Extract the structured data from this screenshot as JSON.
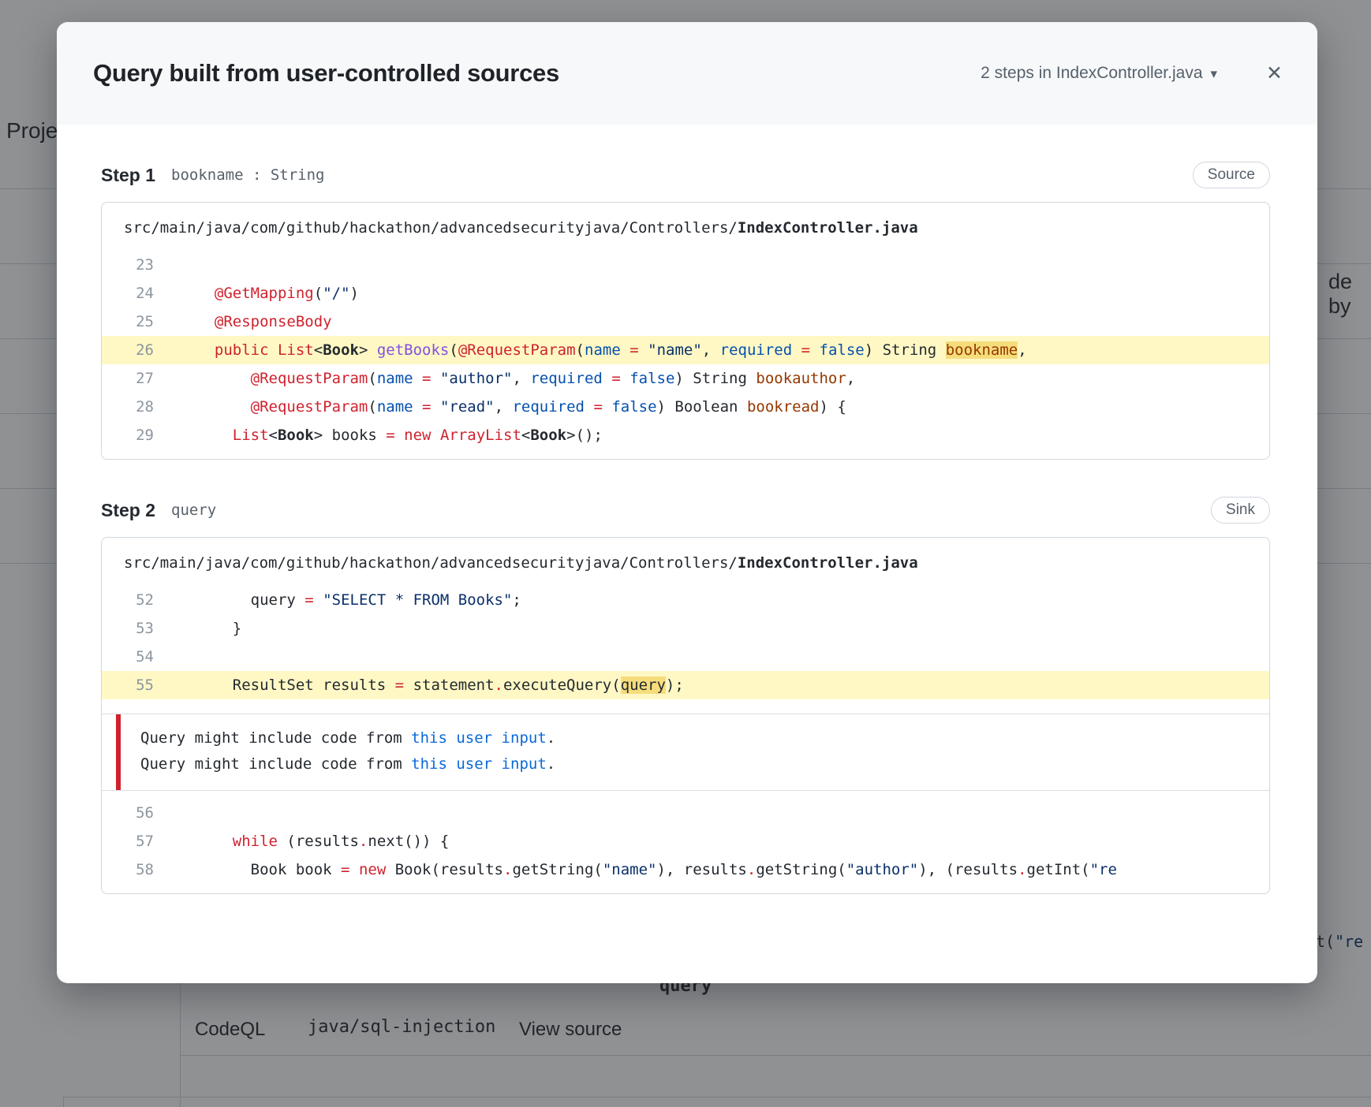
{
  "modal": {
    "title": "Query built from user-controlled sources",
    "steps_dropdown": "2 steps in IndexController.java",
    "icons": {
      "close": "✕",
      "caret": "▾"
    },
    "steps": [
      {
        "label": "Step 1",
        "sublabel": "bookname : String",
        "badge": "Source",
        "file_path_prefix": "src/main/java/com/github/hackathon/advancedsecurityjava/Controllers/",
        "file_name": "IndexController.java",
        "blocks": [
          {
            "type": "lines",
            "lines": [
              {
                "num": "23",
                "indent": 0,
                "hl": false,
                "seg": []
              },
              {
                "num": "24",
                "indent": 2,
                "hl": false,
                "seg": [
                  [
                    "k",
                    "@GetMapping"
                  ],
                  [
                    "p",
                    "("
                  ],
                  [
                    "s",
                    "\"/\""
                  ],
                  [
                    "p",
                    ")"
                  ]
                ]
              },
              {
                "num": "25",
                "indent": 2,
                "hl": false,
                "seg": [
                  [
                    "k",
                    "@ResponseBody"
                  ]
                ]
              },
              {
                "num": "26",
                "indent": 2,
                "hl": true,
                "seg": [
                  [
                    "k",
                    "public"
                  ],
                  [
                    "p",
                    " "
                  ],
                  [
                    "k",
                    "List"
                  ],
                  [
                    "p",
                    "<"
                  ],
                  [
                    "t",
                    "Book"
                  ],
                  [
                    "p",
                    "> "
                  ],
                  [
                    "e",
                    "getBooks"
                  ],
                  [
                    "p",
                    "("
                  ],
                  [
                    "k",
                    "@RequestParam"
                  ],
                  [
                    "p",
                    "("
                  ],
                  [
                    "c",
                    "name"
                  ],
                  [
                    "p",
                    " "
                  ],
                  [
                    "k",
                    "="
                  ],
                  [
                    "p",
                    " "
                  ],
                  [
                    "s",
                    "\"name\""
                  ],
                  [
                    "p",
                    ", "
                  ],
                  [
                    "c",
                    "required"
                  ],
                  [
                    "p",
                    " "
                  ],
                  [
                    "k",
                    "="
                  ],
                  [
                    "p",
                    " "
                  ],
                  [
                    "c",
                    "false"
                  ],
                  [
                    "p",
                    ") String "
                  ],
                  [
                    "vh",
                    "bookname"
                  ],
                  [
                    "p",
                    ","
                  ]
                ]
              },
              {
                "num": "27",
                "indent": 6,
                "hl": false,
                "seg": [
                  [
                    "k",
                    "@RequestParam"
                  ],
                  [
                    "p",
                    "("
                  ],
                  [
                    "c",
                    "name"
                  ],
                  [
                    "p",
                    " "
                  ],
                  [
                    "k",
                    "="
                  ],
                  [
                    "p",
                    " "
                  ],
                  [
                    "s",
                    "\"author\""
                  ],
                  [
                    "p",
                    ", "
                  ],
                  [
                    "c",
                    "required"
                  ],
                  [
                    "p",
                    " "
                  ],
                  [
                    "k",
                    "="
                  ],
                  [
                    "p",
                    " "
                  ],
                  [
                    "c",
                    "false"
                  ],
                  [
                    "p",
                    ") String "
                  ],
                  [
                    "v",
                    "bookauthor"
                  ],
                  [
                    "p",
                    ","
                  ]
                ]
              },
              {
                "num": "28",
                "indent": 6,
                "hl": false,
                "seg": [
                  [
                    "k",
                    "@RequestParam"
                  ],
                  [
                    "p",
                    "("
                  ],
                  [
                    "c",
                    "name"
                  ],
                  [
                    "p",
                    " "
                  ],
                  [
                    "k",
                    "="
                  ],
                  [
                    "p",
                    " "
                  ],
                  [
                    "s",
                    "\"read\""
                  ],
                  [
                    "p",
                    ", "
                  ],
                  [
                    "c",
                    "required"
                  ],
                  [
                    "p",
                    " "
                  ],
                  [
                    "k",
                    "="
                  ],
                  [
                    "p",
                    " "
                  ],
                  [
                    "c",
                    "false"
                  ],
                  [
                    "p",
                    ") Boolean "
                  ],
                  [
                    "v",
                    "bookread"
                  ],
                  [
                    "p",
                    ") {"
                  ]
                ]
              },
              {
                "num": "29",
                "indent": 4,
                "hl": false,
                "seg": [
                  [
                    "k",
                    "List"
                  ],
                  [
                    "p",
                    "<"
                  ],
                  [
                    "t",
                    "Book"
                  ],
                  [
                    "p",
                    "> books "
                  ],
                  [
                    "k",
                    "="
                  ],
                  [
                    "p",
                    " "
                  ],
                  [
                    "k",
                    "new"
                  ],
                  [
                    "p",
                    " "
                  ],
                  [
                    "k",
                    "ArrayList"
                  ],
                  [
                    "p",
                    "<"
                  ],
                  [
                    "t",
                    "Book"
                  ],
                  [
                    "p",
                    ">();"
                  ]
                ]
              }
            ]
          }
        ]
      },
      {
        "label": "Step 2",
        "sublabel": "query",
        "badge": "Sink",
        "file_path_prefix": "src/main/java/com/github/hackathon/advancedsecurityjava/Controllers/",
        "file_name": "IndexController.java",
        "blocks": [
          {
            "type": "lines",
            "lines": [
              {
                "num": "52",
                "indent": 6,
                "hl": false,
                "seg": [
                  [
                    "p",
                    "query "
                  ],
                  [
                    "k",
                    "="
                  ],
                  [
                    "p",
                    " "
                  ],
                  [
                    "s",
                    "\"SELECT * FROM Books\""
                  ],
                  [
                    "p",
                    ";"
                  ]
                ]
              },
              {
                "num": "53",
                "indent": 4,
                "hl": false,
                "seg": [
                  [
                    "p",
                    "}"
                  ]
                ]
              },
              {
                "num": "54",
                "indent": 0,
                "hl": false,
                "seg": []
              },
              {
                "num": "55",
                "indent": 4,
                "hl": true,
                "seg": [
                  [
                    "p",
                    "ResultSet results "
                  ],
                  [
                    "k",
                    "="
                  ],
                  [
                    "p",
                    " statement"
                  ],
                  [
                    "k",
                    "."
                  ],
                  [
                    "p",
                    "executeQuery("
                  ],
                  [
                    "ph",
                    "query"
                  ],
                  [
                    "p",
                    ");"
                  ]
                ]
              }
            ]
          },
          {
            "type": "annotation",
            "lines": [
              {
                "seg": [
                  [
                    "p",
                    "Query might include code from "
                  ],
                  [
                    "a",
                    "this user input"
                  ],
                  [
                    "p",
                    "."
                  ]
                ]
              },
              {
                "seg": [
                  [
                    "p",
                    "Query might include code from "
                  ],
                  [
                    "a",
                    "this user input"
                  ],
                  [
                    "p",
                    "."
                  ]
                ]
              }
            ]
          },
          {
            "type": "lines",
            "lines": [
              {
                "num": "56",
                "indent": 0,
                "hl": false,
                "seg": []
              },
              {
                "num": "57",
                "indent": 4,
                "hl": false,
                "seg": [
                  [
                    "k",
                    "while"
                  ],
                  [
                    "p",
                    " (results"
                  ],
                  [
                    "k",
                    "."
                  ],
                  [
                    "p",
                    "next()) {"
                  ]
                ]
              },
              {
                "num": "58",
                "indent": 6,
                "hl": false,
                "seg": [
                  [
                    "p",
                    "Book book "
                  ],
                  [
                    "k",
                    "="
                  ],
                  [
                    "p",
                    " "
                  ],
                  [
                    "k",
                    "new"
                  ],
                  [
                    "p",
                    " Book(results"
                  ],
                  [
                    "k",
                    "."
                  ],
                  [
                    "p",
                    "getString("
                  ],
                  [
                    "s",
                    "\"name\""
                  ],
                  [
                    "p",
                    "), results"
                  ],
                  [
                    "k",
                    "."
                  ],
                  [
                    "p",
                    "getString("
                  ],
                  [
                    "s",
                    "\"author\""
                  ],
                  [
                    "p",
                    "), (results"
                  ],
                  [
                    "k",
                    "."
                  ],
                  [
                    "p",
                    "getInt("
                  ],
                  [
                    "s",
                    "\"re"
                  ]
                ]
              }
            ]
          }
        ]
      }
    ]
  },
  "background": {
    "left_heading": "Proje",
    "right_text": "de by",
    "right_code_plain": "t(",
    "right_code_string": "\"re",
    "cut_code_word": "query",
    "row": {
      "tool": "CodeQL",
      "rule": "java/sql-injection",
      "action": "View source"
    }
  },
  "colors": {
    "link_accent": "#0969da",
    "highlight_row": "#fff8c5",
    "highlight_token": "#f6dd7c",
    "annotation_red": "#cf222e",
    "badge_border": "#d0d7de",
    "muted_text": "#57606a",
    "header_bg": "#f6f8fa"
  }
}
